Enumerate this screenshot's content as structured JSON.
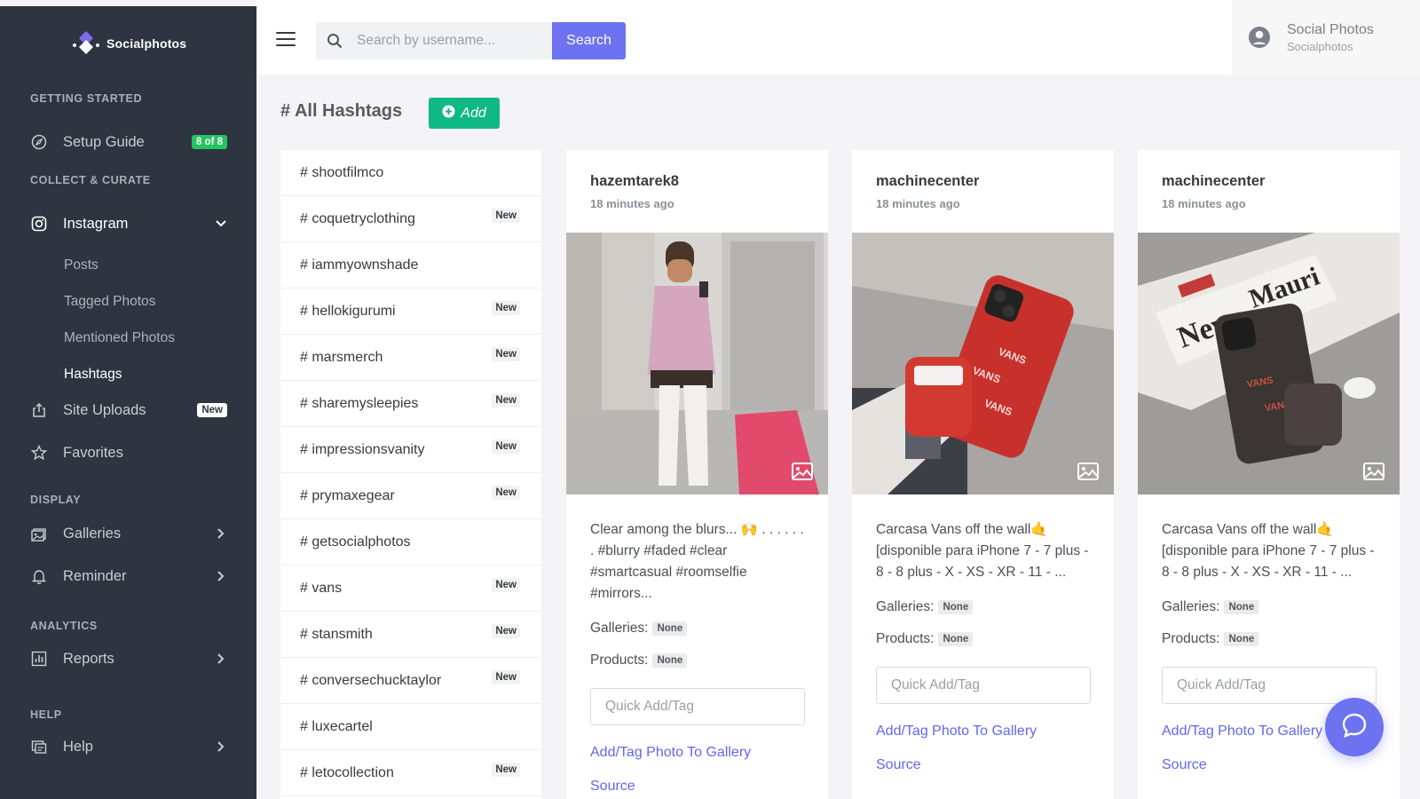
{
  "brand": {
    "name": "Socialphotos"
  },
  "sidebar": {
    "sections": {
      "getting_started": "Getting Started",
      "collect": "Collect & Curate",
      "display": "Display",
      "analytics": "Analytics",
      "help": "Help"
    },
    "setup_guide": {
      "label": "Setup Guide",
      "badge": "8 of 8"
    },
    "instagram": {
      "label": "Instagram"
    },
    "instagram_sub": [
      "Posts",
      "Tagged Photos",
      "Mentioned Photos",
      "Hashtags"
    ],
    "site_uploads": {
      "label": "Site Uploads",
      "badge": "New"
    },
    "favorites": {
      "label": "Favorites"
    },
    "galleries": {
      "label": "Galleries"
    },
    "reminder": {
      "label": "Reminder"
    },
    "reports": {
      "label": "Reports"
    },
    "help": {
      "label": "Help"
    }
  },
  "topbar": {
    "search_placeholder": "Search by username...",
    "search_label": "Search",
    "user_name": "Social Photos",
    "user_sub": "Socialphotos"
  },
  "page": {
    "title": "# All Hashtags",
    "add_label": "Add"
  },
  "hashtags": [
    {
      "tag": "# shootfilmco",
      "badge": ""
    },
    {
      "tag": "# coquetryclothing",
      "badge": "New"
    },
    {
      "tag": "# iammyownshade",
      "badge": ""
    },
    {
      "tag": "# hellokigurumi",
      "badge": "New"
    },
    {
      "tag": "# marsmerch",
      "badge": "New"
    },
    {
      "tag": "# sharemysleepies",
      "badge": "New"
    },
    {
      "tag": "# impressionsvanity",
      "badge": "New"
    },
    {
      "tag": "# prymaxegear",
      "badge": "New"
    },
    {
      "tag": "# getsocialphotos",
      "badge": ""
    },
    {
      "tag": "# vans",
      "badge": "New"
    },
    {
      "tag": "# stansmith",
      "badge": "New"
    },
    {
      "tag": "# conversechucktaylor",
      "badge": "New"
    },
    {
      "tag": "# luxecartel",
      "badge": ""
    },
    {
      "tag": "# letocollection",
      "badge": "New"
    }
  ],
  "cards": [
    {
      "user": "hazemtarek8",
      "time": "18 minutes ago",
      "caption": "Clear among the blurs... 🙌 . . . . . . . #blurry #faded #clear #smartcasual #roomselfie #mirrors...",
      "galleries_label": "Galleries:",
      "galleries_value": "None",
      "products_label": "Products:",
      "products_value": "None",
      "quick_placeholder": "Quick Add/Tag",
      "add_link": "Add/Tag Photo To Gallery",
      "source_link": "Source"
    },
    {
      "user": "machinecenter",
      "time": "18 minutes ago",
      "caption": "Carcasa Vans off the wall🤙 [disponible para iPhone 7 - 7 plus - 8 - 8 plus - X - XS - XR - 11 - ...",
      "galleries_label": "Galleries:",
      "galleries_value": "None",
      "products_label": "Products:",
      "products_value": "None",
      "quick_placeholder": "Quick Add/Tag",
      "add_link": "Add/Tag Photo To Gallery",
      "source_link": "Source"
    },
    {
      "user": "machinecenter",
      "time": "18 minutes ago",
      "caption": "Carcasa Vans off the wall🤙 [disponible para iPhone 7 - 7 plus - 8 - 8 plus - X - XS - XR - 11 - ...",
      "galleries_label": "Galleries:",
      "galleries_value": "None",
      "products_label": "Products:",
      "products_value": "None",
      "quick_placeholder": "Quick Add/Tag",
      "add_link": "Add/Tag Photo To Gallery",
      "source_link": "Source"
    }
  ],
  "colors": {
    "sidebar_bg": "#2f3441",
    "accent": "#6c72f0",
    "success": "#10b981",
    "link": "#6366f1"
  }
}
